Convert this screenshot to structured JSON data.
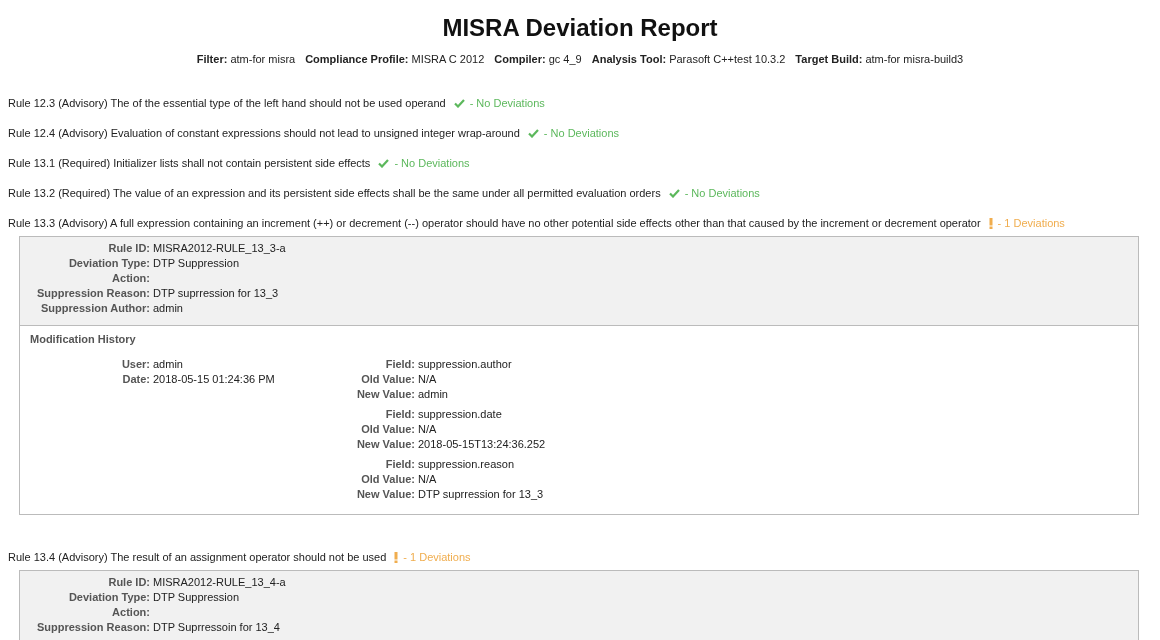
{
  "title": "MISRA Deviation Report",
  "filters": [
    {
      "label": "Filter:",
      "value": "atm-for misra"
    },
    {
      "label": "Compliance Profile:",
      "value": "MISRA C 2012"
    },
    {
      "label": "Compiler:",
      "value": "gc 4_9"
    },
    {
      "label": "Analysis Tool:",
      "value": "Parasoft C++test 10.3.2"
    },
    {
      "label": "Target Build:",
      "value": "atm-for misra-build3"
    }
  ],
  "rules": [
    {
      "text": "Rule 12.3 (Advisory) The of the essential type of the left hand should not be used operand",
      "kind": "ok",
      "status": "- No Deviations"
    },
    {
      "text": "Rule 12.4 (Advisory) Evaluation of constant expressions should not lead to unsigned integer wrap-around",
      "kind": "ok",
      "status": "- No Deviations"
    },
    {
      "text": "Rule 13.1 (Required) Initializer lists shall not contain persistent side effects",
      "kind": "ok",
      "status": "- No Deviations"
    },
    {
      "text": "Rule 13.2 (Required) The value of an expression and its persistent side effects shall be the same under all permitted evaluation orders",
      "kind": "ok",
      "status": "- No Deviations"
    },
    {
      "text": "Rule 13.3 (Advisory) A full expression containing an increment (++) or decrement (--) operator should have no other potential side effects other than that caused by the increment or decrement operator",
      "kind": "deviation",
      "status": "- 1 Deviations",
      "deviation": {
        "fields": [
          {
            "label": "Rule ID:",
            "value": "MISRA2012-RULE_13_3-a"
          },
          {
            "label": "Deviation Type:",
            "value": "DTP Suppression"
          },
          {
            "label": "Action:"
          },
          {
            "label": "Suppression Reason:",
            "value": "DTP suprression for 13_3"
          },
          {
            "label": "Suppression Author:",
            "value": "admin"
          }
        ],
        "history": {
          "title": "Modification History",
          "entries": [
            {
              "who": [
                {
                  "label": "User:",
                  "value": "admin"
                },
                {
                  "label": "Date:",
                  "value": "2018-05-15 01:24:36 PM"
                }
              ],
              "changes": [
                [
                  {
                    "label": "Field:",
                    "value": "suppression.author"
                  },
                  {
                    "label": "Old Value:",
                    "value": "N/A"
                  },
                  {
                    "label": "New Value:",
                    "value": "admin"
                  }
                ],
                [
                  {
                    "label": "Field:",
                    "value": "suppression.date"
                  },
                  {
                    "label": "Old Value:",
                    "value": "N/A"
                  },
                  {
                    "label": "New Value:",
                    "value": "2018-05-15T13:24:36.252"
                  }
                ],
                [
                  {
                    "label": "Field:",
                    "value": "suppression.reason"
                  },
                  {
                    "label": "Old Value:",
                    "value": "N/A"
                  },
                  {
                    "label": "New Value:",
                    "value": "DTP suprression for 13_3"
                  }
                ]
              ]
            }
          ]
        }
      }
    },
    {
      "text": "Rule 13.4 (Advisory) The result of an assignment operator should not be used",
      "kind": "deviation",
      "status": "- 1 Deviations",
      "deviation": {
        "fields": [
          {
            "label": "Rule ID:",
            "value": "MISRA2012-RULE_13_4-a"
          },
          {
            "label": "Deviation Type:",
            "value": "DTP Suppression"
          },
          {
            "label": "Action:"
          },
          {
            "label": "Suppression Reason:",
            "value": "DTP Suprressoin for 13_4"
          }
        ]
      }
    }
  ]
}
